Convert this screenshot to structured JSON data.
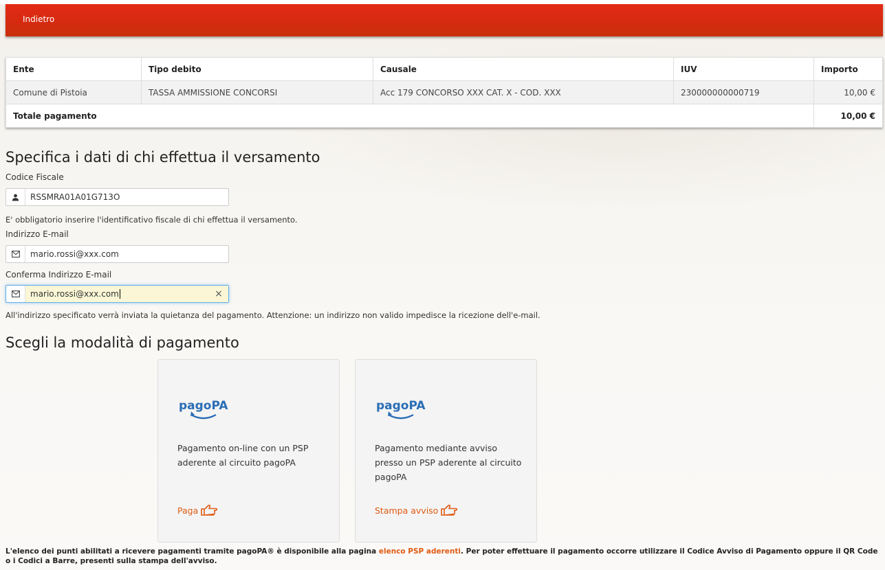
{
  "topbar": {
    "back_label": "Indietro"
  },
  "table": {
    "headers": [
      "Ente",
      "Tipo debito",
      "Causale",
      "IUV",
      "Importo"
    ],
    "row": [
      "Comune di Pistoia",
      "TASSA AMMISSIONE CONCORSI",
      "Acc 179 CONCORSO XXX CAT. X - COD. XXX",
      "230000000000719",
      "10,00 €"
    ],
    "total_label": "Totale pagamento",
    "total_value": "10,00 €"
  },
  "payer": {
    "heading": "Specifica i dati di chi effettua il versamento",
    "cf_label": "Codice Fiscale",
    "cf_value": "RSSMRA01A01G713O",
    "cf_help": "E' obbligatorio inserire l'identificativo fiscale di chi effettua il versamento.",
    "email_label": "Indirizzo E-mail",
    "email_value": "mario.rossi@xxx.com",
    "confirm_label": "Conferma Indirizzo E-mail",
    "confirm_value": "mario.rossi@xxx.com",
    "email_help": "All'indirizzo specificato verrà inviata la quietanza del pagamento. Attenzione: un indirizzo non valido impedisce la ricezione dell'e-mail."
  },
  "payment": {
    "heading": "Scegli la modalità di pagamento",
    "logo_text": "pagoPA",
    "options": [
      {
        "description": "Pagamento on-line con un PSP aderente al circuito pagoPA",
        "action": "Paga"
      },
      {
        "description": "Pagamento mediante avviso presso un PSP aderente al circuito pagoPA",
        "action": "Stampa avviso"
      }
    ]
  },
  "footer": {
    "text_before": "L'elenco dei punti abilitati a ricevere pagamenti tramite pagoPA® è disponibile alla pagina ",
    "link": "elenco PSP aderenti",
    "text_after": ". Per poter effettuare il pagamento occorre utilizzare il Codice Avviso di Pagamento oppure il QR Code o i Codici a Barre, presenti sulla stampa dell'avviso."
  },
  "colors": {
    "primary": "#d62a10",
    "accent": "#e05a12",
    "logo_blue": "#2a6db5"
  }
}
